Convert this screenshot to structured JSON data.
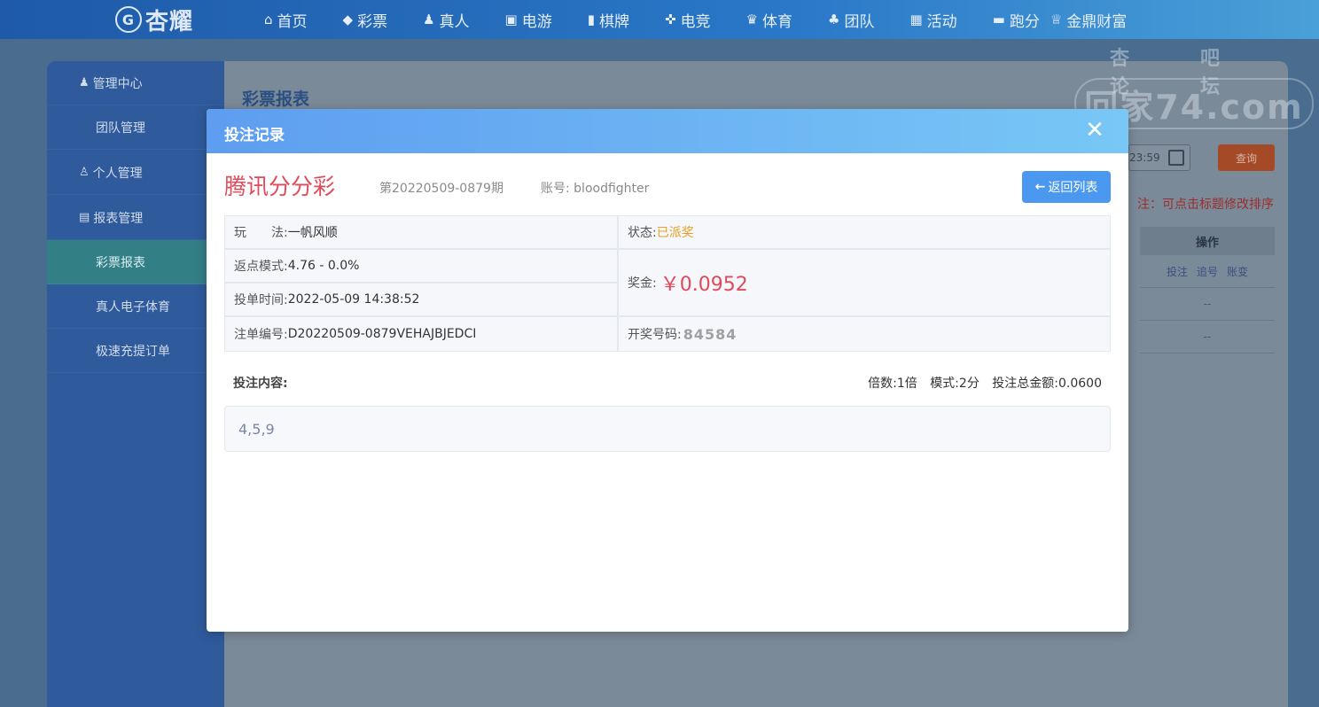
{
  "nav": {
    "logo": "杏耀",
    "items": [
      {
        "label": "首页",
        "icon": "home-icon"
      },
      {
        "label": "彩票",
        "icon": "ticket-icon"
      },
      {
        "label": "真人",
        "icon": "person-icon"
      },
      {
        "label": "电游",
        "icon": "slot-icon"
      },
      {
        "label": "棋牌",
        "icon": "card-icon"
      },
      {
        "label": "电竞",
        "icon": "gamepad-icon"
      },
      {
        "label": "体育",
        "icon": "trophy-icon"
      },
      {
        "label": "团队",
        "icon": "team-icon"
      },
      {
        "label": "活动",
        "icon": "gift-icon"
      },
      {
        "label": "跑分",
        "icon": "car-icon"
      },
      {
        "label": "金鼎财富",
        "icon": "crown-icon"
      }
    ]
  },
  "sidebar": {
    "items": [
      {
        "label": "管理中心",
        "type": "group",
        "icon": "users-icon"
      },
      {
        "label": "团队管理",
        "type": "sub"
      },
      {
        "label": "个人管理",
        "type": "group",
        "icon": "user-icon"
      },
      {
        "label": "报表管理",
        "type": "group",
        "icon": "report-icon"
      },
      {
        "label": "彩票报表",
        "type": "sub",
        "active": true
      },
      {
        "label": "真人电子体育",
        "type": "sub"
      },
      {
        "label": "极速充提订单",
        "type": "sub"
      }
    ]
  },
  "main": {
    "title": "彩票报表",
    "date_text": "23:59",
    "query_label": "查询",
    "note": "注：可点击标题修改排序",
    "ops_header": "操作",
    "ops_links": [
      "投注",
      "追号",
      "账变"
    ],
    "ops_empty": [
      "--",
      "--"
    ]
  },
  "watermark": {
    "top": "杏吧 论坛",
    "main": "回家74.com"
  },
  "modal": {
    "title": "投注记录",
    "close_glyph": "✕",
    "lottery_name": "腾讯分分彩",
    "issue": "第20220509-0879期",
    "account_label": "账号:",
    "account": "bloodfighter",
    "back_label": "返回列表",
    "play_label": "玩　　法:",
    "play_value": "一帆风顺",
    "status_label": "状态:",
    "status_value": "已派奖",
    "rebate_label": "返点模式:",
    "rebate_value": "4.76 - 0.0%",
    "prize_label": "奖金:",
    "prize_value": "￥0.0952",
    "time_label": "投单时间:",
    "time_value": "2022-05-09 14:38:52",
    "order_label": "注单编号:",
    "order_value": "D20220509-0879VEHAJBJEDCI",
    "draw_label": "开奖号码:",
    "draw_value": "84584",
    "content_label": "投注内容:",
    "multiple_label": "倍数:",
    "multiple_value": "1倍",
    "mode_label": "模式:",
    "mode_value": "2分",
    "total_label": "投注总金额:",
    "total_value": "0.0600",
    "bet_content": "4,5,9"
  }
}
